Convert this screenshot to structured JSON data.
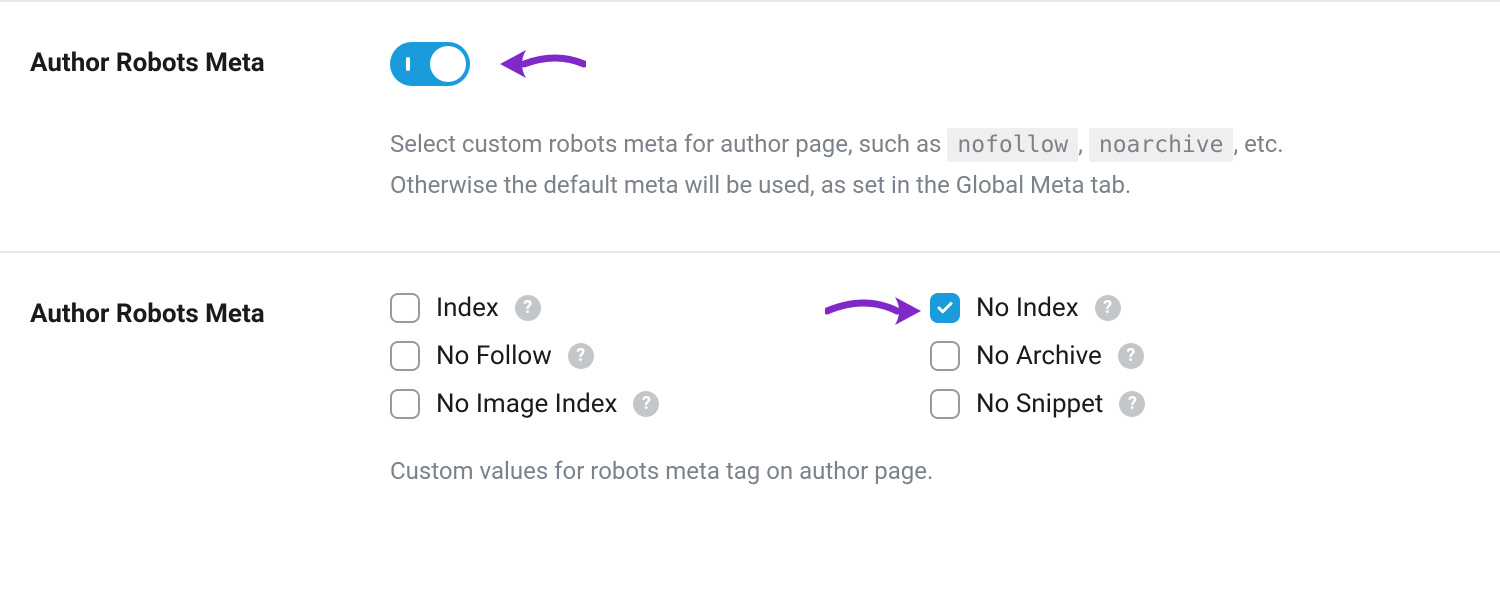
{
  "colors": {
    "accent": "#1a9bdb",
    "annotation": "#7f29c9",
    "muted": "#7b828a"
  },
  "section1": {
    "label": "Author Robots Meta",
    "toggle_on": true,
    "desc_pre": "Select custom robots meta for author page, such as ",
    "code1": "nofollow",
    "sep": ", ",
    "code2": "noarchive",
    "desc_post": ", etc. Otherwise the default meta will be used, as set in the Global Meta tab."
  },
  "section2": {
    "label": "Author Robots Meta",
    "options": [
      {
        "label": "Index",
        "checked": false
      },
      {
        "label": "No Index",
        "checked": true
      },
      {
        "label": "No Follow",
        "checked": false
      },
      {
        "label": "No Archive",
        "checked": false
      },
      {
        "label": "No Image Index",
        "checked": false
      },
      {
        "label": "No Snippet",
        "checked": false
      }
    ],
    "desc": "Custom values for robots meta tag on author page."
  }
}
